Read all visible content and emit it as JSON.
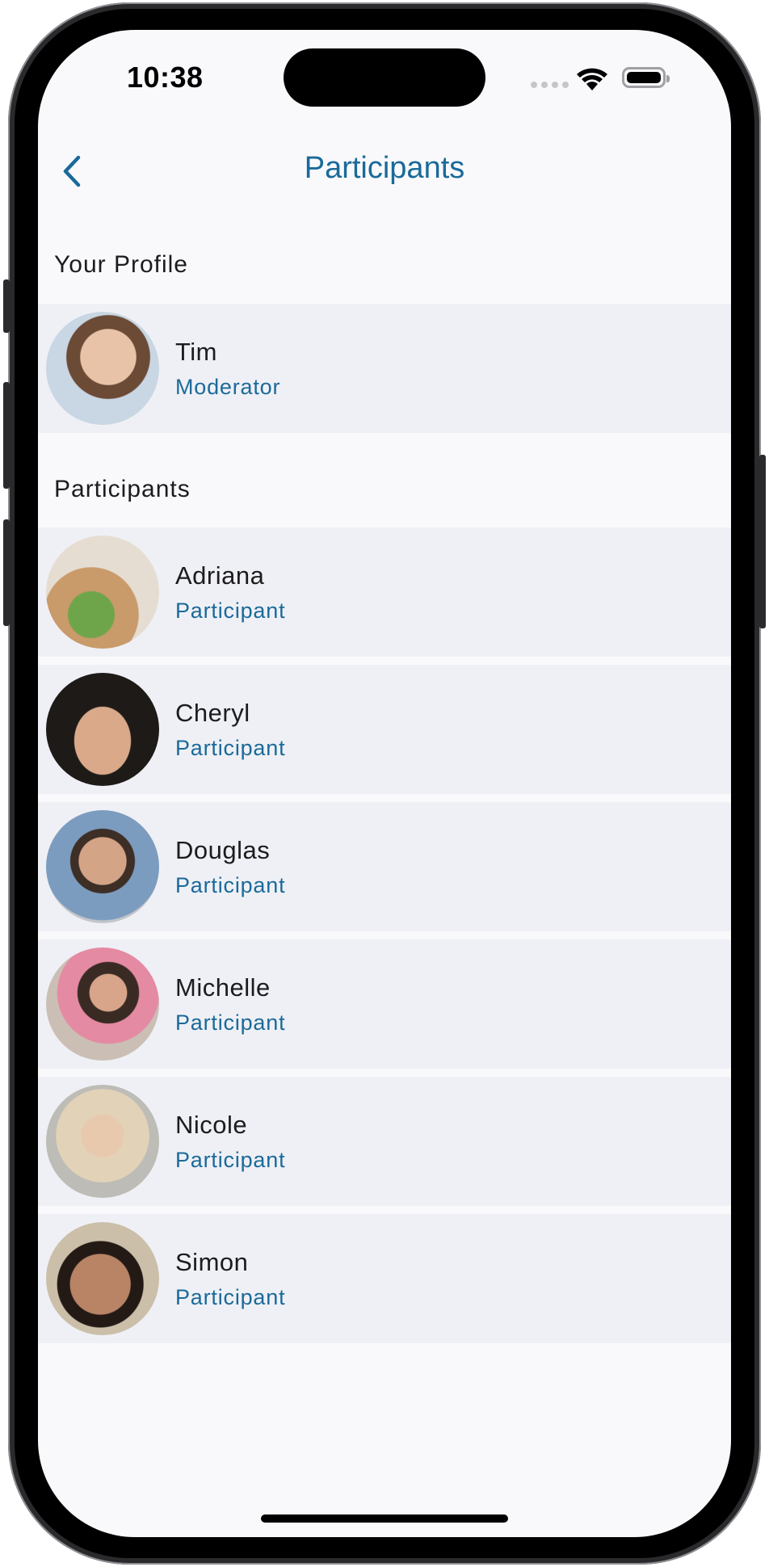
{
  "status_bar": {
    "time": "10:38"
  },
  "nav": {
    "title": "Participants",
    "back_icon": "chevron-left-icon"
  },
  "colors": {
    "accent": "#1a6a9a",
    "row_bg": "#eff0f5",
    "page_bg": "#f9f9fb"
  },
  "profile_section": {
    "header": "Your Profile",
    "user": {
      "name": "Tim",
      "role": "Moderator"
    }
  },
  "participants_section": {
    "header": "Participants",
    "items": [
      {
        "name": "Adriana",
        "role": "Participant"
      },
      {
        "name": "Cheryl",
        "role": "Participant"
      },
      {
        "name": "Douglas",
        "role": "Participant"
      },
      {
        "name": "Michelle",
        "role": "Participant"
      },
      {
        "name": "Nicole",
        "role": "Participant"
      },
      {
        "name": "Simon",
        "role": "Participant"
      }
    ]
  }
}
